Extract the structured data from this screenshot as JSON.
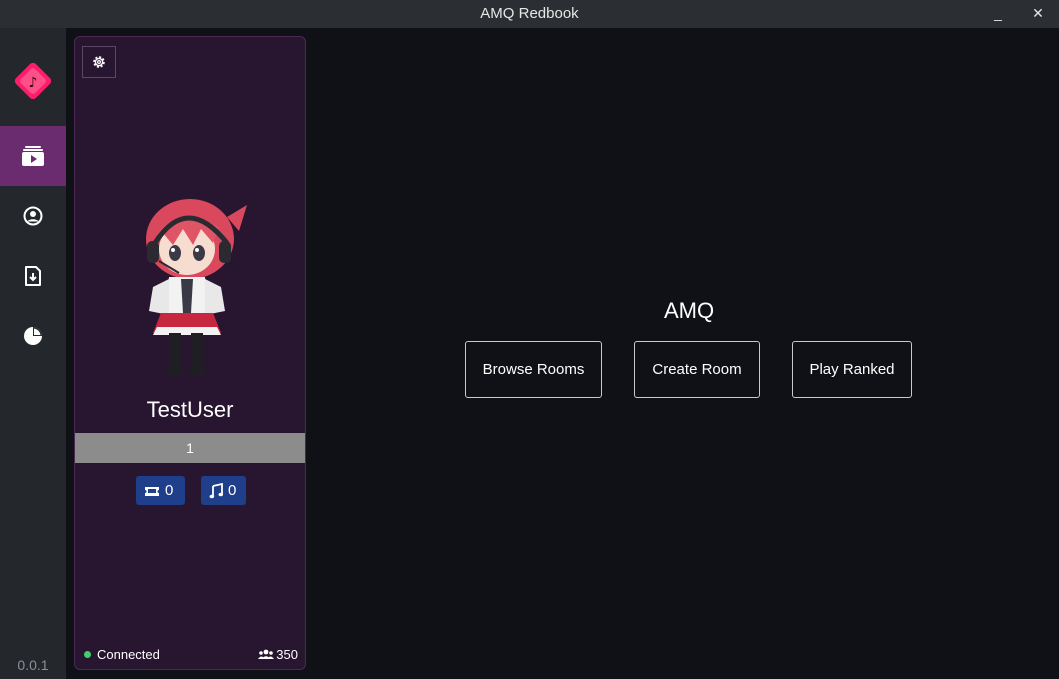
{
  "window": {
    "title": "AMQ Redbook",
    "minimize_label": "_",
    "close_label": "✕"
  },
  "sidebar": {
    "version": "0.0.1",
    "items": [
      {
        "icon": "play-icon",
        "active": true
      },
      {
        "icon": "user-circle-icon",
        "active": false
      },
      {
        "icon": "file-download-icon",
        "active": false
      },
      {
        "icon": "pie-chart-icon",
        "active": false
      }
    ]
  },
  "profile": {
    "username": "TestUser",
    "level": "1",
    "tickets": "0",
    "notes": "0",
    "status": "Connected",
    "online_count": "350"
  },
  "main": {
    "title": "AMQ",
    "buttons": {
      "browse": "Browse Rooms",
      "create": "Create Room",
      "ranked": "Play Ranked"
    }
  },
  "colors": {
    "accent": "#6a2c6e",
    "card_bg": "#281530",
    "badge_bg": "#1f3f8a",
    "status_dot": "#3ecf6e"
  }
}
